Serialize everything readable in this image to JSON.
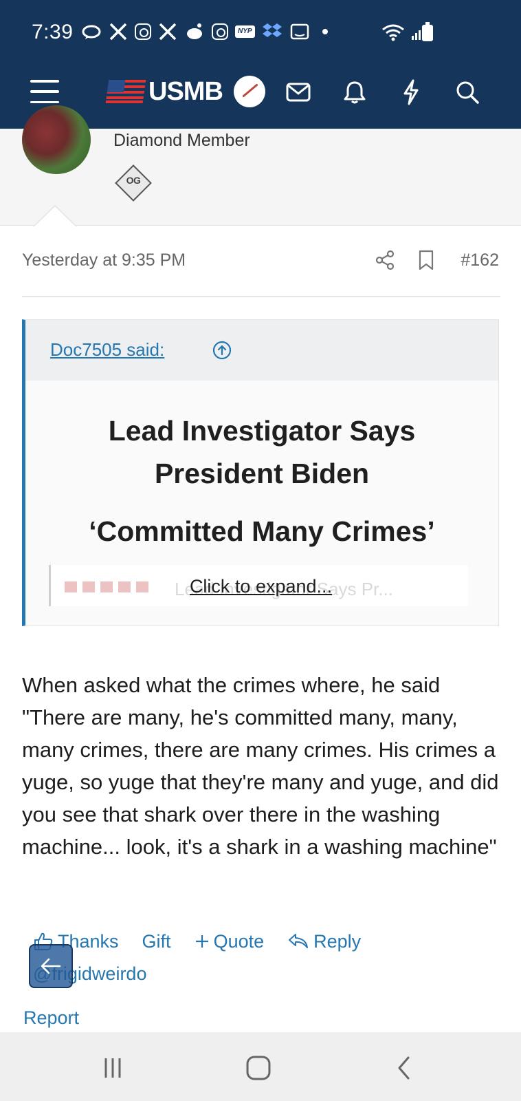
{
  "status_bar": {
    "time": "7:39",
    "nyp_label": "NYP",
    "icons": [
      "chat-bubble-icon",
      "x-icon",
      "instagram-icon",
      "x-icon",
      "reddit-icon",
      "instagram-icon",
      "nyp-icon",
      "dropbox-icon",
      "amazon-icon",
      "dot-icon",
      "wifi-icon",
      "signal-icon",
      "battery-icon"
    ]
  },
  "header": {
    "logo_text": "USMB",
    "icons": [
      "menu-icon",
      "mail-icon",
      "bell-icon",
      "lightning-icon",
      "search-icon"
    ]
  },
  "member": {
    "title": "Diamond Member",
    "badge_text": "OG"
  },
  "post": {
    "timestamp": "Yesterday at 9:35 PM",
    "number": "#162",
    "quote": {
      "author": "Doc7505 said:",
      "headline_line1": "Lead Investigator Says",
      "headline_line2": "President Biden",
      "headline_line3": "‘Committed Many Crimes’",
      "faded_preview": "Lead Investigator Says Pr...",
      "expand_label": "Click to expand..."
    },
    "body": "When asked what the crimes where, he said \"There are many, he's committed many, many, many crimes, there are many crimes. His crimes a yuge, so yuge that they're many and yuge, and did you see that shark over there in the washing machine... look, it's a shark in a washing machine\"",
    "actions": {
      "thanks": "Thanks",
      "gift": "Gift",
      "quote": "Quote",
      "reply": "Reply"
    },
    "mention": "@frigidweirdo",
    "report": "Report"
  },
  "colors": {
    "header_bg": "#15365a",
    "link": "#2577b1",
    "quote_border": "#2577b1"
  }
}
